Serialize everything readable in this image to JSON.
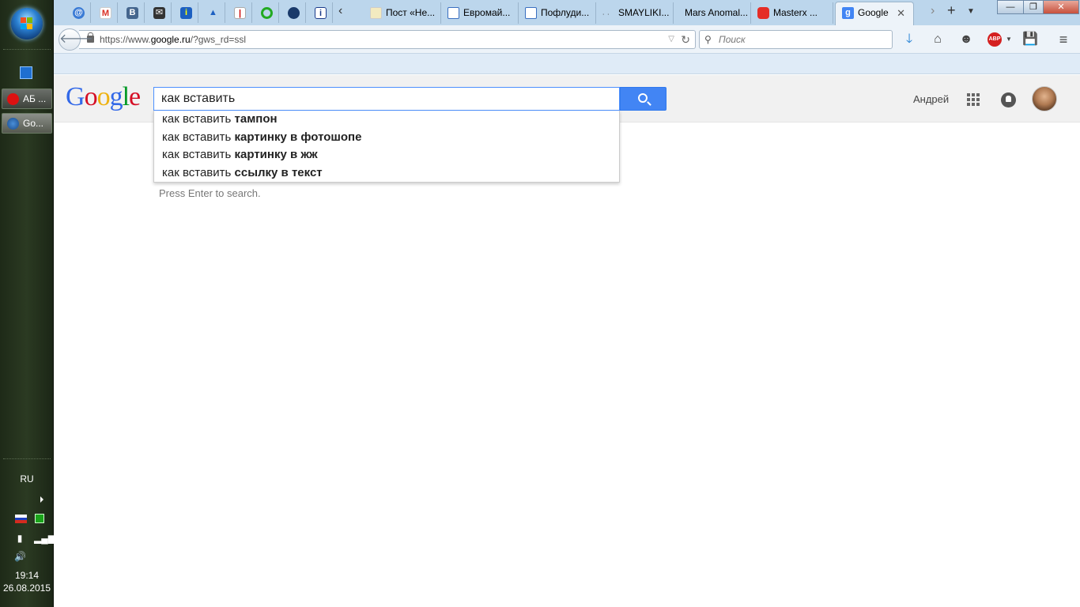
{
  "taskbar": {
    "tasks": [
      {
        "label": "АБ ..."
      },
      {
        "label": "Go..."
      }
    ],
    "lang": "RU",
    "time": "19:14",
    "date": "26.08.2015"
  },
  "browser": {
    "tabs": [
      {
        "label": "Пост «Не..."
      },
      {
        "label": "Евромай..."
      },
      {
        "label": "Пофлуди..."
      },
      {
        "label": "SMAYLIKI..."
      },
      {
        "label": "Mars Anomal..."
      },
      {
        "label": "Masterx ..."
      },
      {
        "label": "Google"
      }
    ],
    "url_prefix": "https://www.",
    "url_host": "google.ru",
    "url_rest": "/?gws_rd=ssl",
    "search_placeholder": "Поиск"
  },
  "google": {
    "query": "как вставить",
    "suggestions": [
      {
        "prefix": "как вставить ",
        "completion": "тампон"
      },
      {
        "prefix": "как вставить ",
        "completion": "картинку в фотошопе"
      },
      {
        "prefix": "как вставить ",
        "completion": "картинку в жж"
      },
      {
        "prefix": "как вставить ",
        "completion": "ссылку в текст"
      }
    ],
    "press_enter": "Press Enter to search.",
    "user_name": "Андрей"
  },
  "colors": {
    "google_blue": "#4285f4",
    "logo": [
      "#3369e8",
      "#d50f25",
      "#eeb211",
      "#3369e8",
      "#009925",
      "#d50f25"
    ]
  }
}
